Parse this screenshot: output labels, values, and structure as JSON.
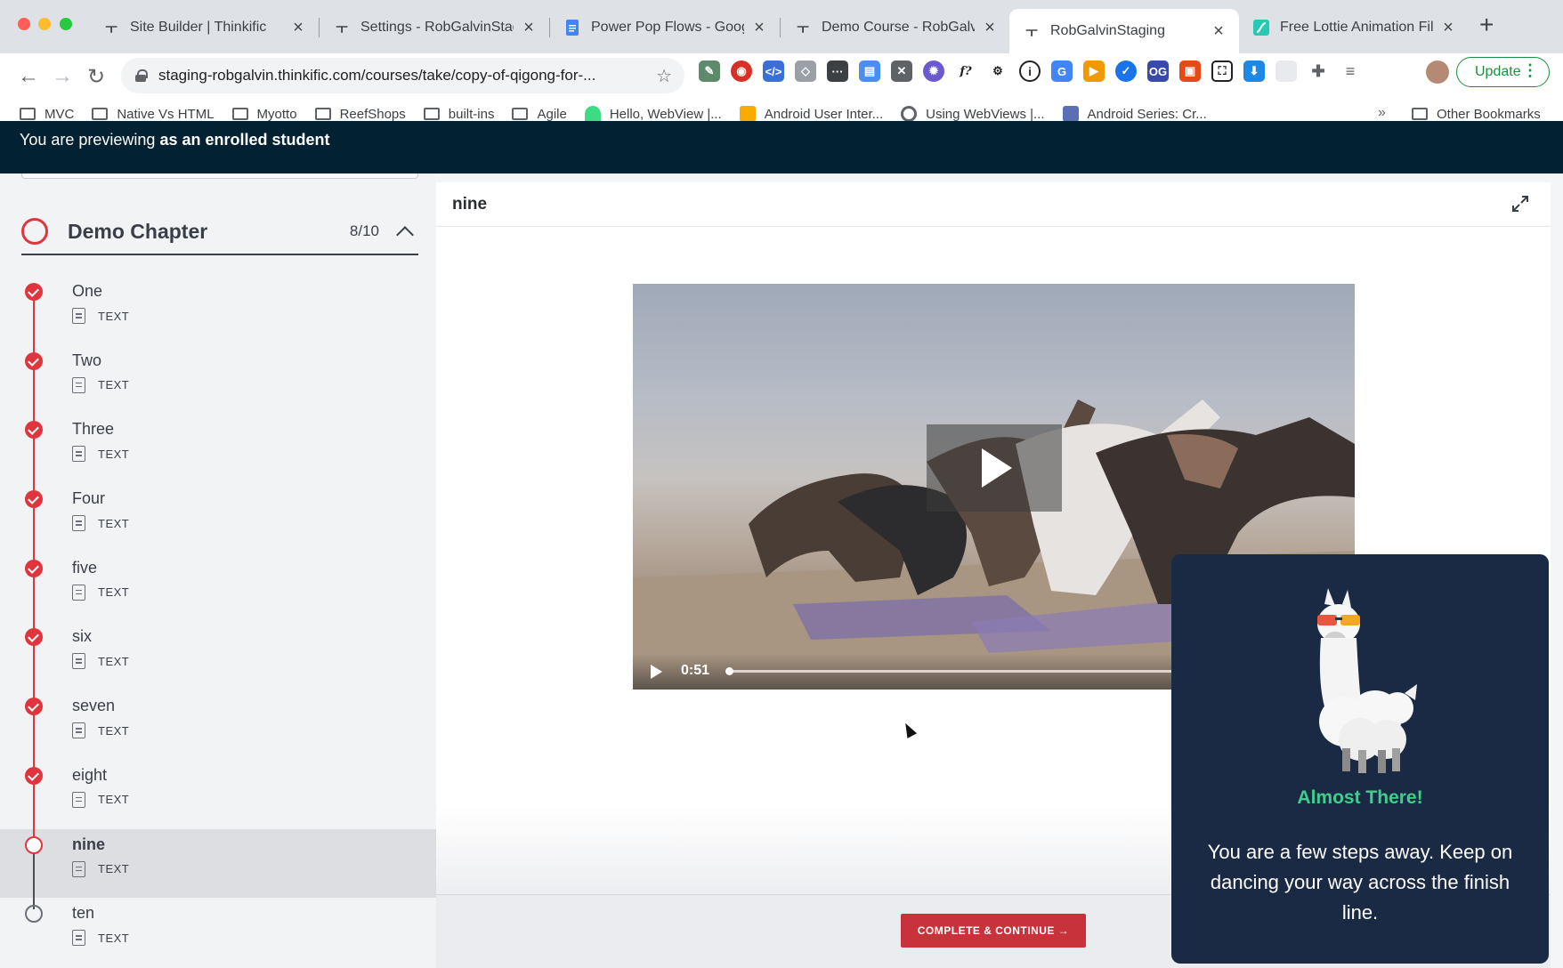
{
  "browser": {
    "tabs": [
      {
        "label": "Site Builder | Thinkific",
        "icon": "thinkific-icon"
      },
      {
        "label": "Settings - RobGalvinStagi",
        "icon": "thinkific-icon"
      },
      {
        "label": "Power Pop Flows - Google",
        "icon": "google-docs-icon"
      },
      {
        "label": "Demo Course - RobGalvin",
        "icon": "thinkific-icon"
      },
      {
        "label": "RobGalvinStaging",
        "icon": "thinkific-icon"
      },
      {
        "label": "Free Lottie Animation File",
        "icon": "lottie-icon"
      }
    ],
    "url": "staging-robgalvin.thinkific.com/courses/take/copy-of-qigong-for-...",
    "update_label": "Update",
    "bookmarks": [
      {
        "label": "MVC",
        "type": "folder"
      },
      {
        "label": "Native Vs HTML",
        "type": "folder"
      },
      {
        "label": "Myotto",
        "type": "folder"
      },
      {
        "label": "ReefShops",
        "type": "folder"
      },
      {
        "label": "built-ins",
        "type": "folder"
      },
      {
        "label": "Agile",
        "type": "folder"
      },
      {
        "label": "Hello, WebView |...",
        "type": "link"
      },
      {
        "label": "Android User Inter...",
        "type": "link"
      },
      {
        "label": "Using WebViews |...",
        "type": "link"
      },
      {
        "label": "Android Series: Cr...",
        "type": "link"
      }
    ],
    "more_bookmarks": "»",
    "other_bookmarks": "Other Bookmarks"
  },
  "banner": {
    "prefix": "You are previewing",
    "emphasis": "as an enrolled student"
  },
  "sidebar": {
    "chapter_title": "Demo Chapter",
    "chapter_progress": "8/10",
    "lessons": [
      {
        "title": "One",
        "type": "TEXT",
        "status": "complete"
      },
      {
        "title": "Two",
        "type": "TEXT",
        "status": "complete"
      },
      {
        "title": "Three",
        "type": "TEXT",
        "status": "complete"
      },
      {
        "title": "Four",
        "type": "TEXT",
        "status": "complete"
      },
      {
        "title": "five",
        "type": "TEXT",
        "status": "complete"
      },
      {
        "title": "six",
        "type": "TEXT",
        "status": "complete"
      },
      {
        "title": "seven",
        "type": "TEXT",
        "status": "complete"
      },
      {
        "title": "eight",
        "type": "TEXT",
        "status": "complete"
      },
      {
        "title": "nine",
        "type": "TEXT",
        "status": "current"
      },
      {
        "title": "ten",
        "type": "TEXT",
        "status": "incomplete"
      }
    ]
  },
  "main": {
    "lesson_title": "nine",
    "video": {
      "time": "0:51",
      "progress": 0.0
    },
    "complete_button": "COMPLETE & CONTINUE →"
  },
  "popup": {
    "title": "Almost There!",
    "body": "You are a few steps away. Keep on dancing your way across the finish line."
  },
  "colors": {
    "accent_red": "#e0353d",
    "banner_bg": "#022233",
    "popup_bg": "#1a2a45",
    "popup_title": "#3ecf8e"
  }
}
